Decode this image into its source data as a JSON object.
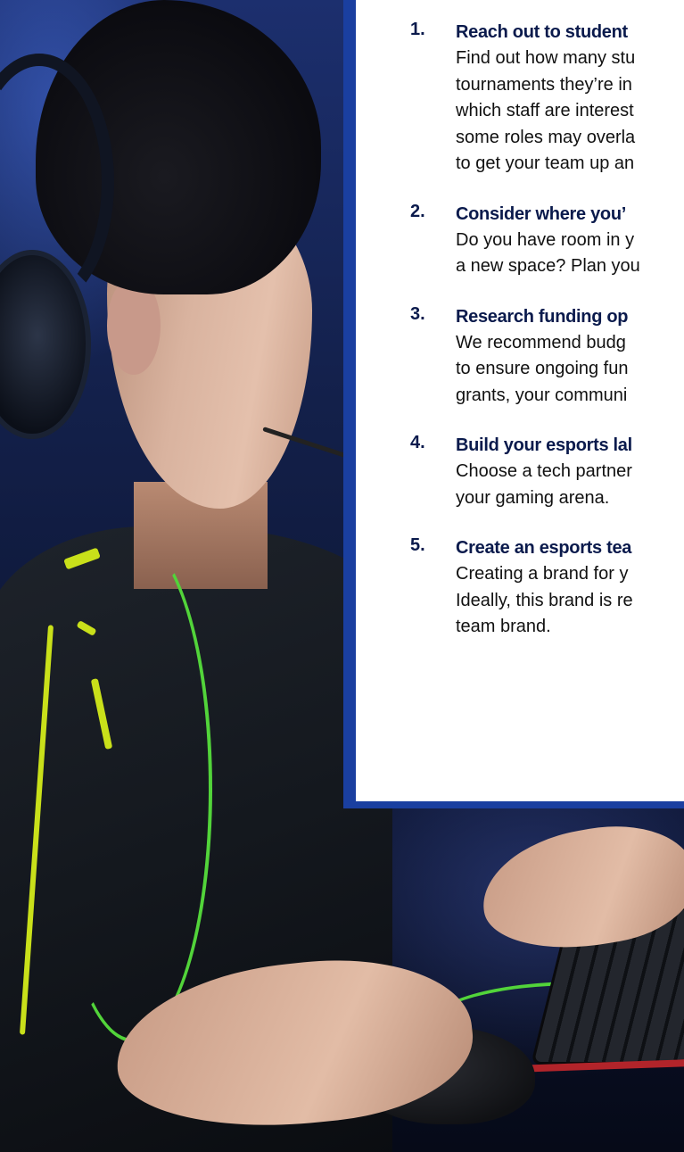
{
  "steps": [
    {
      "number": "1.",
      "title": "Reach out to student",
      "lines": [
        "Find out how many stu",
        "tournaments they’re in",
        "which staff are interest",
        "some roles may overla",
        "to get your team up an"
      ]
    },
    {
      "number": "2.",
      "title": "Consider where you’",
      "lines": [
        "Do you have room in y",
        "a new space? Plan you"
      ]
    },
    {
      "number": "3.",
      "title": "Research funding op",
      "lines": [
        "We recommend budg",
        "to ensure ongoing fun",
        "grants, your communi"
      ]
    },
    {
      "number": "4.",
      "title": "Build your esports lal",
      "lines": [
        "Choose a tech partner",
        "your gaming arena."
      ]
    },
    {
      "number": "5.",
      "title": "Create an esports tea",
      "lines": [
        "Creating a brand for y",
        "Ideally, this brand is re",
        "team brand."
      ]
    }
  ],
  "colors": {
    "panel_border": "#1a3fa0",
    "title_text": "#0a1a4c",
    "body_text": "#111111",
    "cable_green": "#52d43a",
    "jacket_accent": "#c9e01a"
  },
  "icons": {
    "photo": "gamer-photo"
  }
}
